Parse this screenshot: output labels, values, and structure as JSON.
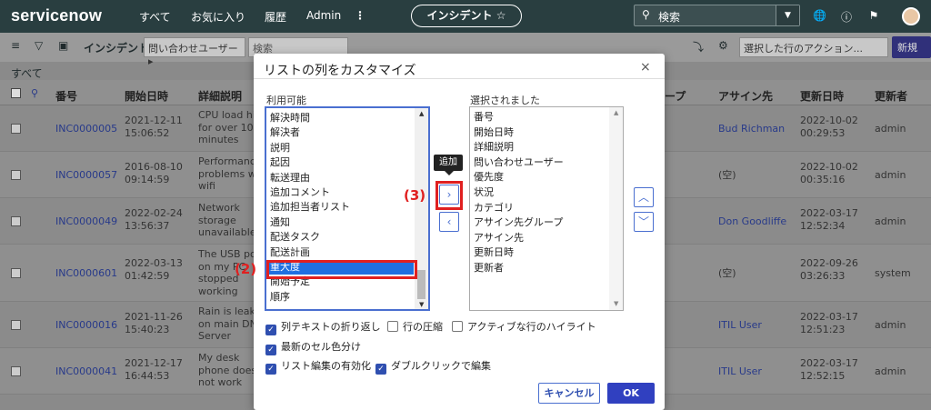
{
  "topnav": {
    "logo": "servicenow",
    "items": [
      "すべて",
      "お気に入り",
      "履歴",
      "Admin"
    ],
    "more": "⋮",
    "context_pill": "インシデント ☆",
    "search_placeholder": "検索",
    "icons": [
      "globe-icon",
      "help-icon",
      "bell-icon"
    ]
  },
  "listbar": {
    "title": "インシデント",
    "filter_select": "問い合わせユーザー ▸",
    "search_placeholder": "検索",
    "actions_select": "選択した行のアクション...",
    "new_button": "新規"
  },
  "breadcrumb": "すべて",
  "table": {
    "headers": [
      "番号",
      "開始日時",
      "詳細説明",
      "アサイン先",
      "更新日時",
      "更新者"
    ],
    "partial_header": "ープ",
    "rows": [
      {
        "number": "INC0000005",
        "opened": [
          "2021-12-11",
          "15:06:52"
        ],
        "desc": [
          "CPU load high",
          "for over 10",
          "minutes"
        ],
        "assigned": "Bud Richman",
        "updated": [
          "2022-10-02",
          "00:29:53"
        ],
        "updated_by": "admin"
      },
      {
        "number": "INC0000057",
        "opened": [
          "2016-08-10",
          "09:14:59"
        ],
        "desc": [
          "Performance",
          "problems with",
          "wifi"
        ],
        "assigned": "(空)",
        "updated": [
          "2022-10-02",
          "00:35:16"
        ],
        "updated_by": "admin"
      },
      {
        "number": "INC0000049",
        "opened": [
          "2022-02-24",
          "13:56:37"
        ],
        "desc": [
          "Network",
          "storage",
          "unavailable"
        ],
        "assigned": "Don Goodliffe",
        "updated": [
          "2022-03-17",
          "12:52:34"
        ],
        "updated_by": "admin"
      },
      {
        "number": "INC0000601",
        "opened": [
          "2022-03-13",
          "01:42:59"
        ],
        "desc": [
          "The USB port",
          "on my PC",
          "stopped",
          "working"
        ],
        "assigned": "(空)",
        "updated": [
          "2022-09-26",
          "03:26:33"
        ],
        "updated_by": "system"
      },
      {
        "number": "INC0000016",
        "opened": [
          "2021-11-26",
          "15:40:23"
        ],
        "desc": [
          "Rain is leaking",
          "on main DNS",
          "Server"
        ],
        "assigned": "ITIL User",
        "updated": [
          "2022-03-17",
          "12:51:23"
        ],
        "updated_by": "admin"
      },
      {
        "number": "INC0000041",
        "opened": [
          "2021-12-17",
          "16:44:53"
        ],
        "desc": [
          "My desk",
          "phone does",
          "not work"
        ],
        "assigned": "ITIL User",
        "updated": [
          "2022-03-17",
          "12:52:15"
        ],
        "updated_by": "admin"
      }
    ]
  },
  "modal": {
    "title": "リストの列をカスタマイズ",
    "close": "×",
    "available_label": "利用可能",
    "selected_label": "選択されました",
    "available": [
      "解決時間",
      "解決者",
      "説明",
      "起因",
      "転送理由",
      "追加コメント",
      "追加担当者リスト",
      "通知",
      "配送タスク",
      "配送計画",
      "重大度",
      "開始予定",
      "順序"
    ],
    "available_selected": "重大度",
    "selected": [
      "番号",
      "開始日時",
      "詳細説明",
      "問い合わせユーザー",
      "優先度",
      "状況",
      "カテゴリ",
      "アサイン先グループ",
      "アサイン先",
      "更新日時",
      "更新者"
    ],
    "add_tooltip": "追加",
    "add_glyph": "›",
    "remove_glyph": "‹",
    "up_glyph": "︿",
    "down_glyph": "﹀",
    "options": [
      {
        "label": "列テキストの折り返し",
        "checked": true
      },
      {
        "label": "行の圧縮",
        "checked": false
      },
      {
        "label": "アクティブな行のハイライト",
        "checked": false
      },
      {
        "label": "最新のセル色分け",
        "checked": true
      },
      {
        "label": "リスト編集の有効化",
        "checked": true
      },
      {
        "label": "ダブルクリックで編集",
        "checked": true
      }
    ],
    "cancel": "キャンセル",
    "ok": "OK"
  },
  "annotations": {
    "step2": "(2)",
    "step3": "(3)"
  },
  "colors": {
    "nav": "#293e40",
    "accent": "#3040c0",
    "highlight": "#e02020",
    "selection": "#1f6fe0"
  }
}
